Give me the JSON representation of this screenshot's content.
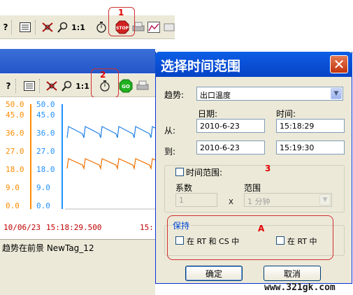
{
  "callouts": {
    "c1": "1",
    "c2": "2",
    "c3": "3",
    "cA": "A"
  },
  "toolbar": {
    "help_glyph": "?",
    "zoom_label": "1:1",
    "go_label": "GO"
  },
  "trend": {
    "y_left_ticks": [
      "50.0",
      "45.0",
      "36.0",
      "27.0",
      "18.0",
      "9.0",
      "0.0"
    ],
    "y_right_ticks": [
      "50.0",
      "45.0",
      "36.0",
      "27.0",
      "18.0",
      "9.0",
      "0.0"
    ],
    "x_date": "10/06/23",
    "x_time": "15:18:29.500",
    "x_time_cut": "15:",
    "status_text": "趋势在前景 NewTag_12",
    "colors": {
      "left_axis": "#ff8c00",
      "right_axis": "#1e90ff",
      "series_blue": "#1e7fe6",
      "series_orange": "#f07000"
    }
  },
  "dialog": {
    "title": "选择时间范围",
    "close_glyph": "✕",
    "trend_label": "趋势:",
    "trend_value": "出口温度",
    "date_header": "日期:",
    "time_header": "时间:",
    "from_label": "从:",
    "to_label": "到:",
    "from_date": "2010-6-23",
    "from_time": "15:18:29",
    "to_date": "2010-6-23",
    "to_time": "15:19:30",
    "time_range_label": "时间范围:",
    "coef_label": "系数",
    "coef_value": "1",
    "x_label": "X",
    "range_label": "范围",
    "range_value": "1 分钟",
    "keep_label": "保持",
    "keep_rt_cs": "在 RT 和 CS 中",
    "keep_rt": "在 RT 中",
    "ok_label": "确定",
    "cancel_label": "取消"
  },
  "watermark": "www.321gk.com"
}
